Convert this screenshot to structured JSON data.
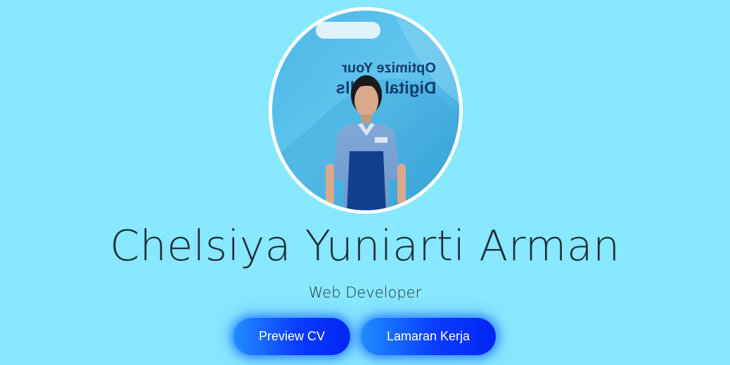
{
  "profile": {
    "name": "Chelsiya Yuniarti Arman",
    "role": "Web Developer",
    "photo_backdrop_text_line1": "Optimize Your",
    "photo_backdrop_text_line2": "Digital Skills"
  },
  "actions": {
    "preview_cv_label": "Preview CV",
    "job_application_label": "Lamaran Kerja"
  },
  "colors": {
    "background": "#87e8ff",
    "text": "#1f2d3a",
    "button_start": "#1f8dff",
    "button_end": "#0024f2",
    "avatar_ring": "#ffffff"
  }
}
